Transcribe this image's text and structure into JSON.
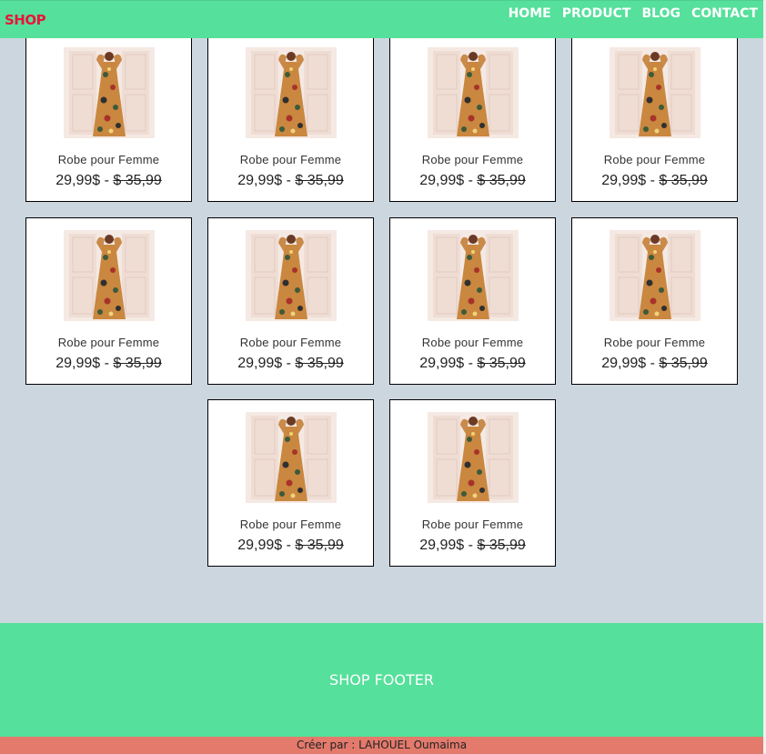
{
  "navbar": {
    "logo": "SHOP",
    "links": [
      "HOME",
      "PRODUCT",
      "BLOG",
      "CONTACT"
    ]
  },
  "products": [
    {
      "name": "Robe pour Femme",
      "price": "29,99$",
      "separator": " - ",
      "old_price": "$ 35,99"
    },
    {
      "name": "Robe pour Femme",
      "price": "29,99$",
      "separator": " - ",
      "old_price": "$ 35,99"
    },
    {
      "name": "Robe pour Femme",
      "price": "29,99$",
      "separator": " - ",
      "old_price": "$ 35,99"
    },
    {
      "name": "Robe pour Femme",
      "price": "29,99$",
      "separator": " - ",
      "old_price": "$ 35,99"
    },
    {
      "name": "Robe pour Femme",
      "price": "29,99$",
      "separator": " - ",
      "old_price": "$ 35,99"
    },
    {
      "name": "Robe pour Femme",
      "price": "29,99$",
      "separator": " - ",
      "old_price": "$ 35,99"
    },
    {
      "name": "Robe pour Femme",
      "price": "29,99$",
      "separator": " - ",
      "old_price": "$ 35,99"
    },
    {
      "name": "Robe pour Femme",
      "price": "29,99$",
      "separator": " - ",
      "old_price": "$ 35,99"
    },
    {
      "name": "Robe pour Femme",
      "price": "29,99$",
      "separator": " - ",
      "old_price": "$ 35,99"
    },
    {
      "name": "Robe pour Femme",
      "price": "29,99$",
      "separator": " - ",
      "old_price": "$ 35,99"
    }
  ],
  "footer": {
    "title": "SHOP FOOTER",
    "credit": "Créer par : LAHOUEL Oumaima"
  },
  "colors": {
    "nav_bg": "#55e09b",
    "logo": "#e8153a",
    "page_bg": "#ccd6df",
    "credit_bg": "#e37a6c"
  },
  "icons": {
    "product_image": "floral-dress-photo"
  }
}
